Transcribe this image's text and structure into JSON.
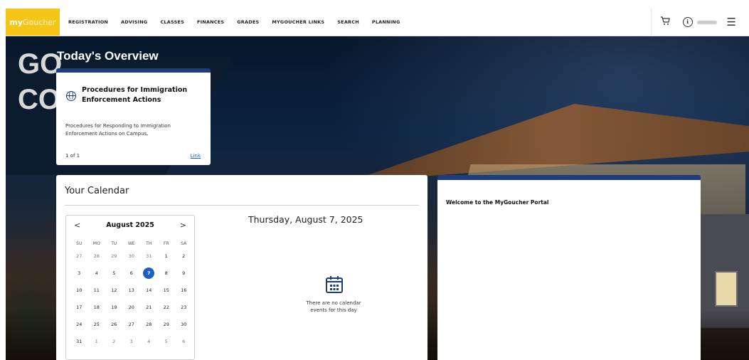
{
  "topbar": {
    "logo_my": "my",
    "logo_rest": "Goucher",
    "nav": [
      "REGISTRATION",
      "ADVISING",
      "CLASSES",
      "FINANCES",
      "GRADES",
      "MYGOUCHER LINKS",
      "SEARCH",
      "PLANNING"
    ],
    "icons": [
      "cart-icon",
      "user-icon",
      "menu-icon"
    ]
  },
  "hero": {
    "letters": "GO\nCO"
  },
  "overview": {
    "title": "Today's Overview",
    "card": {
      "title": "Procedures for Immigration Enforcement Actions",
      "description": "Procedures for Responding to Immigration Enforcement Actions on Campus.",
      "count": "1 of 1",
      "link": "Link",
      "icon": "globe-icon"
    }
  },
  "calendar": {
    "title": "Your Calendar",
    "month": "August 2025",
    "prev": "<",
    "next": ">",
    "weekdays": [
      "SU",
      "MO",
      "TU",
      "WE",
      "TH",
      "FR",
      "SA"
    ],
    "weeks": [
      [
        "27",
        "28",
        "29",
        "30",
        "31",
        "1",
        "2"
      ],
      [
        "3",
        "4",
        "5",
        "6",
        "7",
        "8",
        "9"
      ],
      [
        "10",
        "11",
        "12",
        "13",
        "14",
        "15",
        "16"
      ],
      [
        "17",
        "18",
        "19",
        "20",
        "21",
        "22",
        "23"
      ],
      [
        "24",
        "25",
        "26",
        "27",
        "28",
        "29",
        "30"
      ],
      [
        "31",
        "1",
        "2",
        "3",
        "4",
        "5",
        "6"
      ]
    ],
    "selected": "7",
    "day_heading": "Thursday, August 7, 2025",
    "no_events": "There are no calendar events for this day",
    "accent": "#1d5fbf"
  },
  "welcome": {
    "title": "Welcome to the MyGoucher Portal"
  }
}
